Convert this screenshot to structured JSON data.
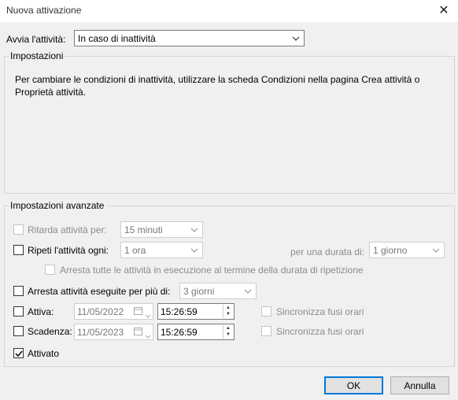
{
  "window": {
    "title": "Nuova attivazione"
  },
  "trigger": {
    "label": "Avvia l'attività:",
    "value": "In caso di inattività"
  },
  "settings": {
    "group_label": "Impostazioni",
    "description": "Per cambiare le condizioni di inattività, utilizzare la scheda Condizioni nella pagina Crea attività o Proprietà attività."
  },
  "advanced": {
    "group_label": "Impostazioni avanzate",
    "delay": {
      "label": "Ritarda attività per:",
      "value": "15 minuti",
      "checked": false,
      "enabled": false
    },
    "repeat": {
      "label": "Ripeti l'attività ogni:",
      "value": "1 ora",
      "checked": false,
      "duration_label": "per una durata di:",
      "duration_value": "1 giorno"
    },
    "stop_all": {
      "label": "Arresta tutte le attività in esecuzione al termine della durata di ripetizione",
      "checked": false,
      "enabled": false
    },
    "stop_longer": {
      "label": "Arresta attività eseguite per più di:",
      "value": "3 giorni",
      "checked": false
    },
    "activate": {
      "label": "Attiva:",
      "date": "11/05/2022",
      "time": "15:26:59",
      "sync_label": "Sincronizza fusi orari",
      "checked": false
    },
    "expire": {
      "label": "Scadenza:",
      "date": "11/05/2023",
      "time": "15:26:59",
      "sync_label": "Sincronizza fusi orari",
      "checked": false
    },
    "enabled": {
      "label": "Attivato",
      "checked": true
    }
  },
  "buttons": {
    "ok": "OK",
    "cancel": "Annulla"
  },
  "colors": {
    "accent": "#0078d7",
    "background": "#f0f0f0"
  }
}
